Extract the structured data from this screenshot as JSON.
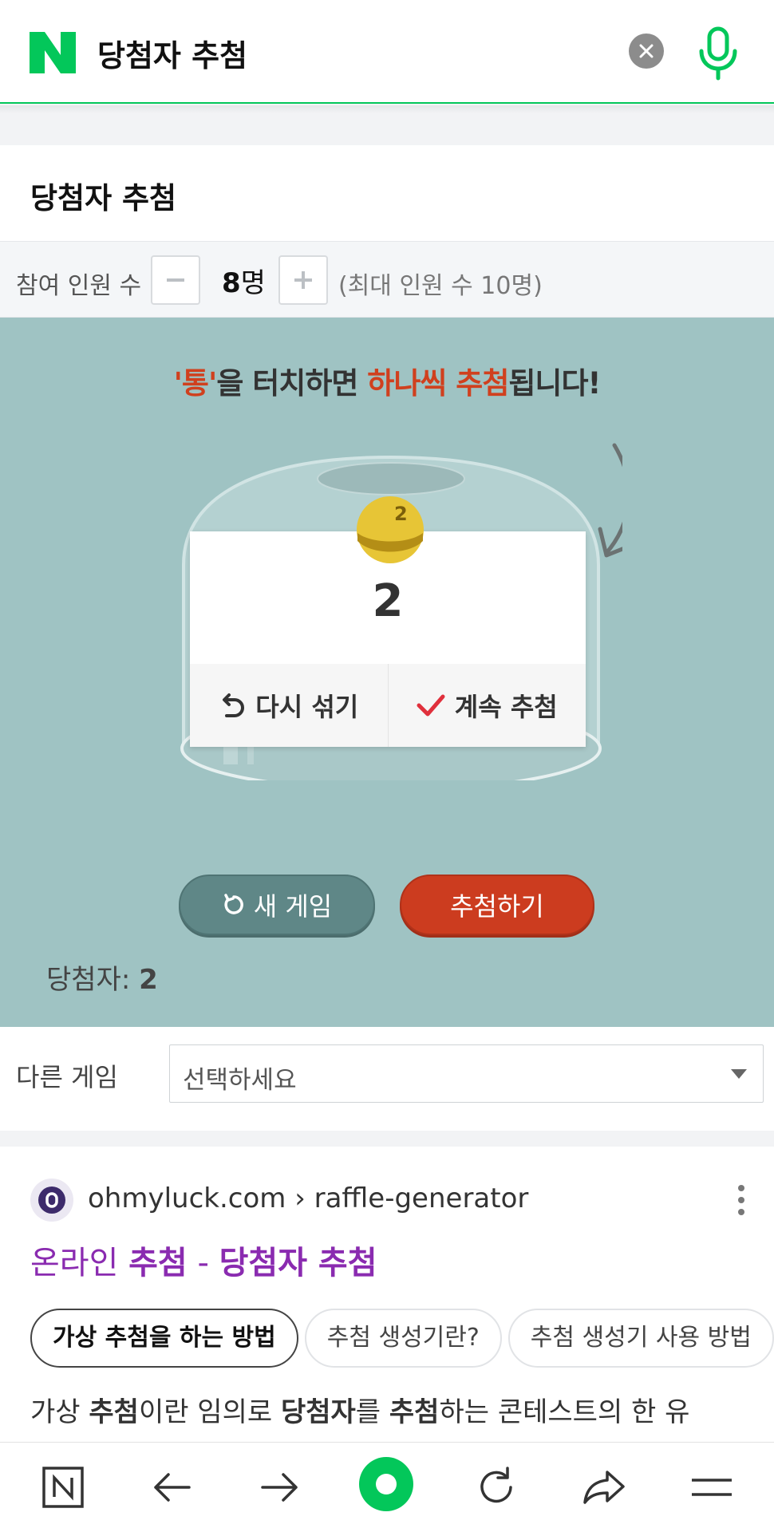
{
  "search": {
    "query": "당첨자 추첨"
  },
  "widget": {
    "title": "당첨자 추첨",
    "participants_label": "참여 인원 수",
    "count_value": "8",
    "count_unit": "명",
    "max_text": "(최대 인원 수 10명)",
    "instruction_part1": "'통'",
    "instruction_part2": "을 터치하면 ",
    "instruction_part3": "하나씩 추첨",
    "instruction_part4": "됩니다!",
    "result_ball_number": "2",
    "result_number": "2",
    "reshuffle_label": "다시 섞기",
    "continue_label": "계속 추첨",
    "new_game_label": "새 게임",
    "draw_label": "추첨하기",
    "winner_label": "당첨자:",
    "winner_value": "2",
    "other_game_label": "다른 게임",
    "select_placeholder": "선택하세요"
  },
  "result": {
    "breadcrumb": "ohmyluck.com › raffle-generator",
    "title_prefix": "온라인 ",
    "title_bold1": "추첨",
    "title_sep": " - ",
    "title_bold2": "당첨자 추첨",
    "chips": [
      "가상 추첨을 하는 방법",
      "추첨 생성기란?",
      "추첨 생성기 사용 방법"
    ],
    "snippet_1": "가상 ",
    "snippet_2": "추첨",
    "snippet_3": "이란 임의로 ",
    "snippet_4": "당첨자",
    "snippet_5": "를 ",
    "snippet_6": "추첨",
    "snippet_7": "하는 콘테스트의 한 유"
  },
  "colors": {
    "naver_green": "#03c75a",
    "game_bg": "#9fc3c3",
    "accent_red": "#cc3c1f",
    "link_purple": "#8a2bb0"
  },
  "icons": [
    "naver-logo-icon",
    "clear-icon",
    "mic-icon",
    "minus-icon",
    "plus-icon",
    "undo-icon",
    "check-icon",
    "refresh-icon",
    "more-icon",
    "home-icon",
    "back-icon",
    "forward-icon",
    "green-dot-icon",
    "reload-icon",
    "share-icon",
    "menu-icon"
  ]
}
